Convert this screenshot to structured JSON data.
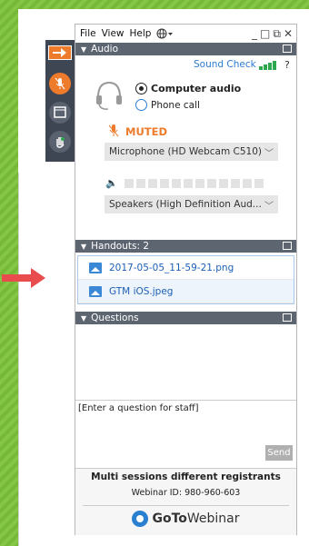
{
  "menu": {
    "file": "File",
    "view": "View",
    "help": "Help"
  },
  "window": {
    "minimize": "_",
    "restore": "□",
    "popout": "⧉",
    "close": "✕"
  },
  "audio": {
    "title": "Audio",
    "sound_check": "Sound Check",
    "help": "?",
    "computer_audio": "Computer audio",
    "phone_call": "Phone call",
    "selected": "Computer audio",
    "muted_label": "MUTED",
    "microphone": "Microphone (HD Webcam C510)",
    "speakers": "Speakers (High Definition Aud..."
  },
  "handouts": {
    "title": "Handouts: 2",
    "items": [
      "2017-05-05_11-59-21.png",
      "GTM iOS.jpeg"
    ]
  },
  "questions": {
    "title": "Questions",
    "input_placeholder": "[Enter a question for staff]",
    "send_label": "Send"
  },
  "footer": {
    "session_title": "Multi sessions different registrants",
    "webinar_id": "Webinar ID: 980-960-603",
    "brand_goto": "GoTo",
    "brand_webinar": "Webinar"
  },
  "colors": {
    "accent": "#ee7a2c",
    "link": "#2a7bd3",
    "header": "#5c6570",
    "toolbar": "#3e4654"
  }
}
